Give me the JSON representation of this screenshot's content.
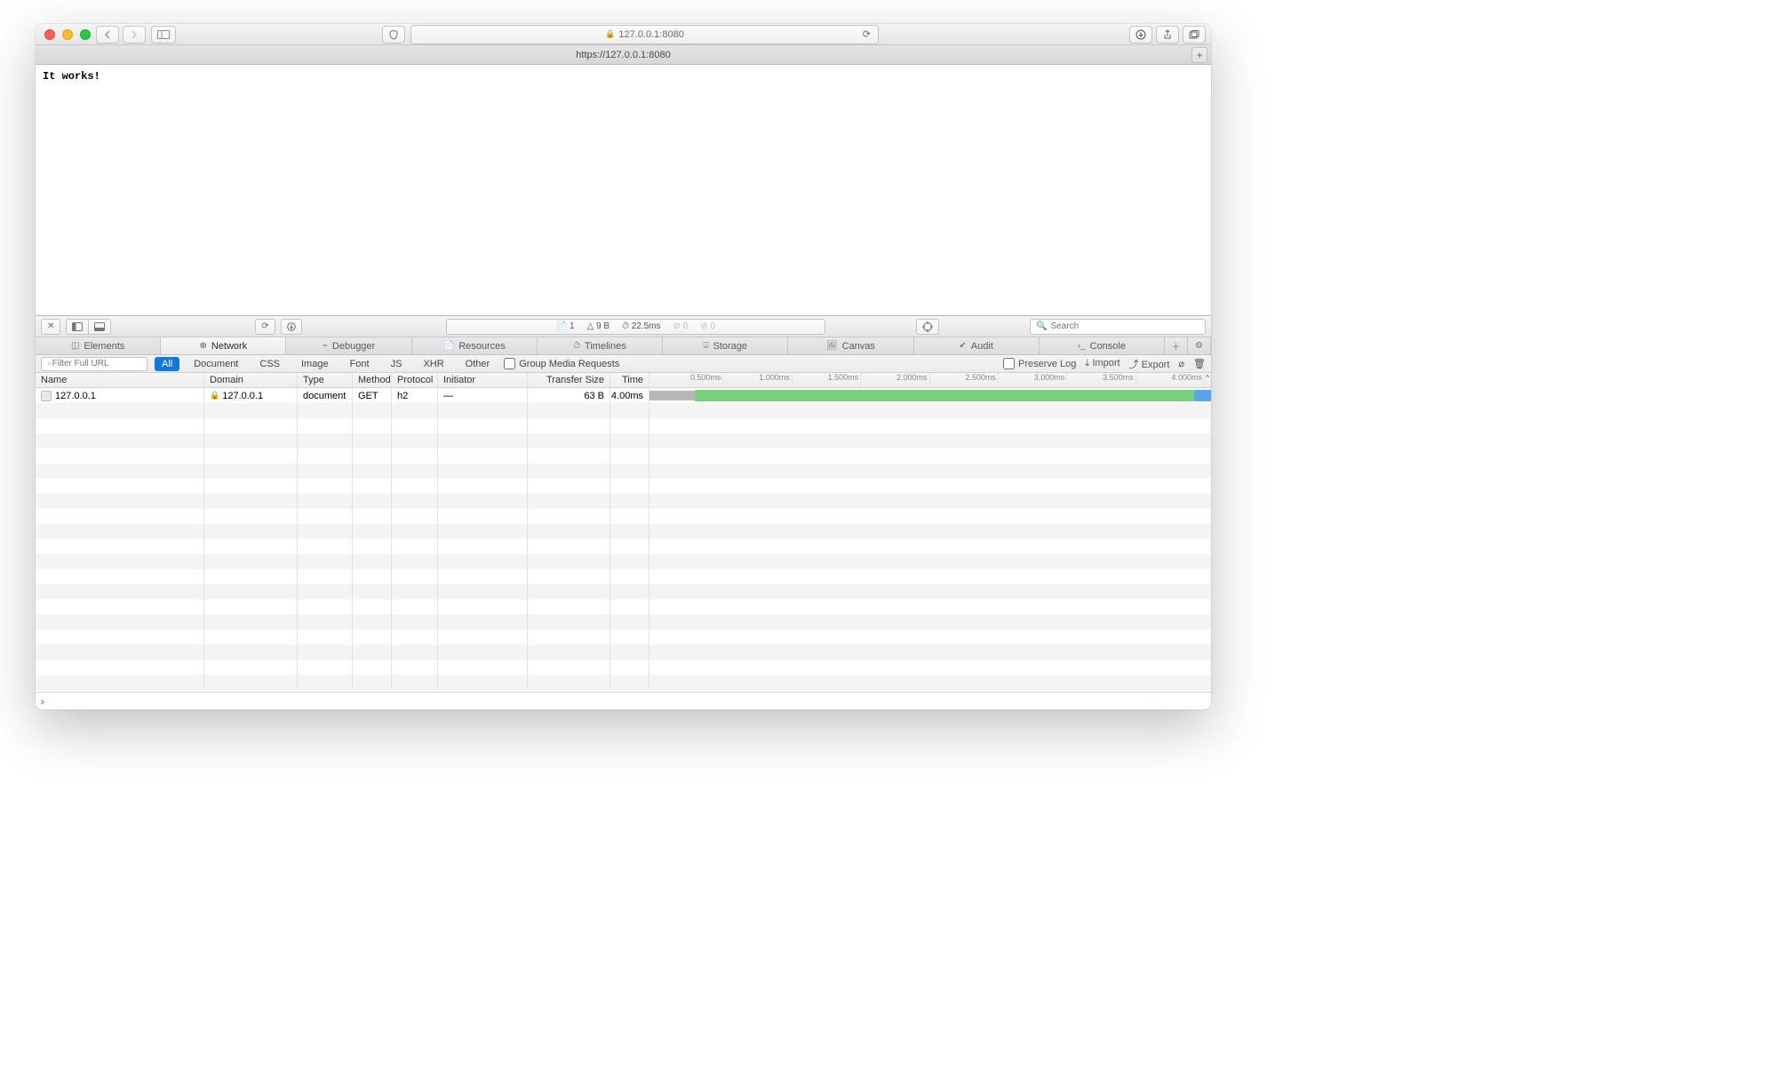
{
  "address_bar": {
    "url": "127.0.0.1:8080"
  },
  "tab": {
    "title": "https://127.0.0.1:8080"
  },
  "page": {
    "content": "It works!"
  },
  "inspector": {
    "summary": {
      "docs": "1",
      "size": "9 B",
      "time": "22.5ms",
      "errors4xx": "0",
      "errors5xx": "0"
    },
    "search_placeholder": "Search",
    "tabs": {
      "elements": "Elements",
      "network": "Network",
      "debugger": "Debugger",
      "resources": "Resources",
      "timelines": "Timelines",
      "storage": "Storage",
      "canvas": "Canvas",
      "audit": "Audit",
      "console": "Console"
    },
    "filter": {
      "placeholder": "Filter Full URL",
      "all": "All",
      "document": "Document",
      "css": "CSS",
      "image": "Image",
      "font": "Font",
      "js": "JS",
      "xhr": "XHR",
      "other": "Other",
      "group": "Group Media Requests",
      "preserve": "Preserve Log",
      "import": "Import",
      "export": "Export"
    },
    "columns": {
      "name": "Name",
      "domain": "Domain",
      "type": "Type",
      "method": "Method",
      "protocol": "Protocol",
      "initiator": "Initiator",
      "transfer": "Transfer Size",
      "time": "Time"
    },
    "ticks": [
      "0.500ms",
      "1.000ms",
      "1.500ms",
      "2.000ms",
      "2.500ms",
      "3.000ms",
      "3.500ms",
      "4.000ms"
    ],
    "rows": [
      {
        "name": "127.0.0.1",
        "domain": "127.0.0.1",
        "type": "document",
        "method": "GET",
        "protocol": "h2",
        "initiator": "—",
        "transfer": "63 B",
        "time": "4.00ms"
      }
    ],
    "console_prompt": "›"
  }
}
